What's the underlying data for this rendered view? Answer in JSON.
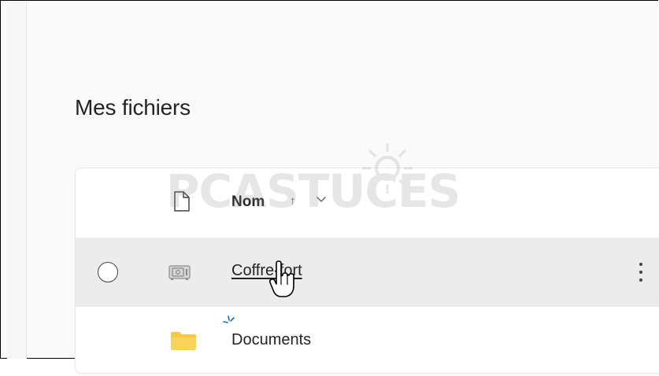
{
  "page": {
    "title": "Mes fichiers"
  },
  "file_list": {
    "header": {
      "file_icon": "file-icon",
      "name_label": "Nom",
      "sort_arrow": "↑",
      "sort_chevron_icon": "chevron-down-icon"
    },
    "items": [
      {
        "name": "Coffre-fort",
        "icon": "vault-icon",
        "selected": true,
        "hovered": true,
        "has_more_menu": true
      },
      {
        "name": "Documents",
        "icon": "folder-icon",
        "selected": false,
        "hovered": false,
        "has_more_menu": false
      }
    ]
  },
  "overlay": {
    "cursor": "hand-pointer-icon",
    "loading_indicator": "loading-spark-icon",
    "watermark_text": "PCASTUCES"
  },
  "colors": {
    "background": "#fafafa",
    "card": "#ffffff",
    "selected_row": "#ececec",
    "text": "#242424",
    "folder_yellow": "#f8c842",
    "loading_blue": "#0f6cbd"
  }
}
